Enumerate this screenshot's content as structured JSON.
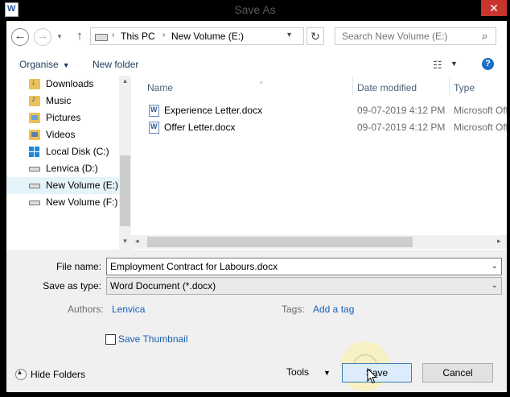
{
  "window": {
    "title": "Save As",
    "close_glyph": "✕"
  },
  "nav": {
    "back_glyph": "←",
    "forward_glyph": "→",
    "recent_glyph": "▾",
    "up_glyph": "↑"
  },
  "address": {
    "crumbs": [
      "This PC",
      "New Volume (E:)"
    ],
    "separator": "›",
    "drop_glyph": "▾",
    "refresh_glyph": "↻"
  },
  "search": {
    "placeholder": "Search New Volume (E:)",
    "icon": "search-icon",
    "glyph": "⌕"
  },
  "toolbar": {
    "organise_label": "Organise",
    "new_folder_label": "New folder",
    "caret": "▼",
    "view_glyph": "☷",
    "help_glyph": "?"
  },
  "sidebar": {
    "items": [
      {
        "label": "Downloads",
        "icon": "downloads-folder-icon"
      },
      {
        "label": "Music",
        "icon": "music-folder-icon"
      },
      {
        "label": "Pictures",
        "icon": "pictures-folder-icon"
      },
      {
        "label": "Videos",
        "icon": "videos-folder-icon"
      },
      {
        "label": "Local Disk (C:)",
        "icon": "windows-drive-icon"
      },
      {
        "label": "Lenvica (D:)",
        "icon": "drive-icon"
      },
      {
        "label": "New Volume (E:)",
        "icon": "drive-icon",
        "selected": true
      },
      {
        "label": "New Volume (F:)",
        "icon": "drive-icon"
      }
    ],
    "scroll_up": "▴",
    "scroll_down": "▾"
  },
  "filelist": {
    "columns": [
      "Name",
      "Date modified",
      "Type"
    ],
    "sort_glyph": "^",
    "rows": [
      {
        "name": "Experience Letter.docx",
        "date": "09-07-2019 4:12 PM",
        "type": "Microsoft Office Word Document"
      },
      {
        "name": "Offer Letter.docx",
        "date": "09-07-2019 4:12 PM",
        "type": "Microsoft Office Word Document"
      }
    ],
    "hscroll_left": "◂",
    "hscroll_right": "▸"
  },
  "form": {
    "file_name_label": "File name:",
    "file_name_value": "Employment Contract for Labours.docx",
    "save_type_label": "Save as type:",
    "save_type_value": "Word Document (*.docx)",
    "dropdown_glyph": "⌄",
    "authors_label": "Authors:",
    "authors_value": "Lenvica",
    "tags_label": "Tags:",
    "tags_value": "Add a tag",
    "thumbnail_label": "Save Thumbnail",
    "thumbnail_checked": false
  },
  "footer": {
    "hide_folders_label": "Hide Folders",
    "tools_label": "Tools",
    "tools_caret": "▼",
    "save_label": "Save",
    "cancel_label": "Cancel"
  },
  "colors": {
    "close_red": "#c7352c",
    "link_blue": "#1a5fb4",
    "selection": "#e5f3fb",
    "save_button_border": "#3c7fb1"
  }
}
